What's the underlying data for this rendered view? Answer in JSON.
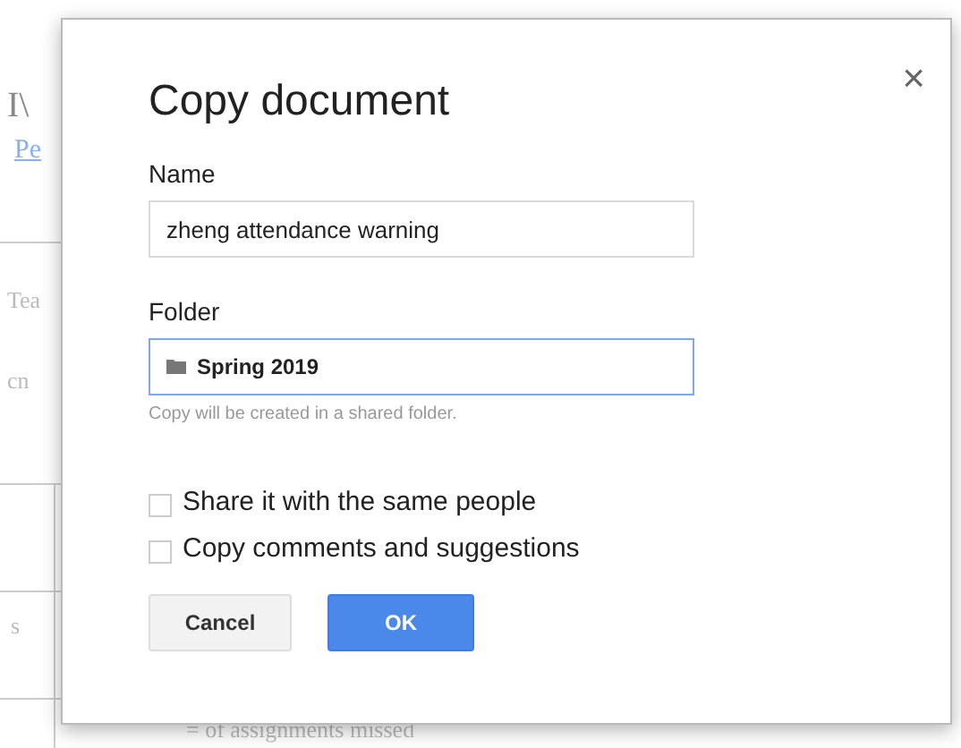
{
  "background_document": {
    "heading_fragment": "I\\",
    "link_fragment": "Pe",
    "text_fragments": [
      "Tea",
      "cn",
      "s",
      "= of assignments missed"
    ]
  },
  "dialog": {
    "title": "Copy document",
    "close": "×",
    "name_field": {
      "label": "Name",
      "value": "zheng attendance warning"
    },
    "folder_field": {
      "label": "Folder",
      "value": "Spring 2019",
      "focused": true,
      "hint": "Copy will be created in a shared folder."
    },
    "options": [
      {
        "label": "Share it with the same people",
        "checked": false
      },
      {
        "label": "Copy comments and suggestions",
        "checked": false
      }
    ],
    "buttons": [
      {
        "label": "Cancel",
        "kind": "secondary"
      },
      {
        "label": "OK",
        "kind": "primary"
      }
    ]
  }
}
